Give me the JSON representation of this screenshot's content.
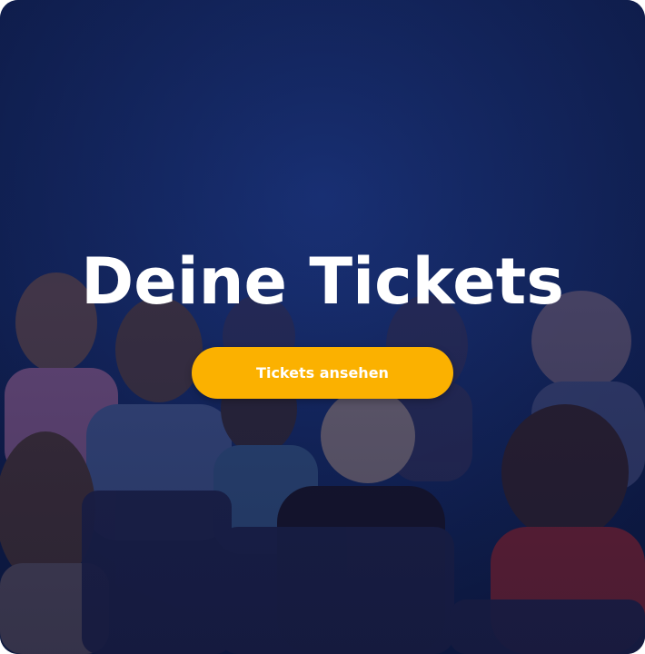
{
  "hero": {
    "title": "Deine Tickets",
    "button_label": "Tickets ansehen",
    "accent_color": "#fbb100",
    "background_color": "#13265f",
    "background_image": "theater-audience-photo"
  }
}
